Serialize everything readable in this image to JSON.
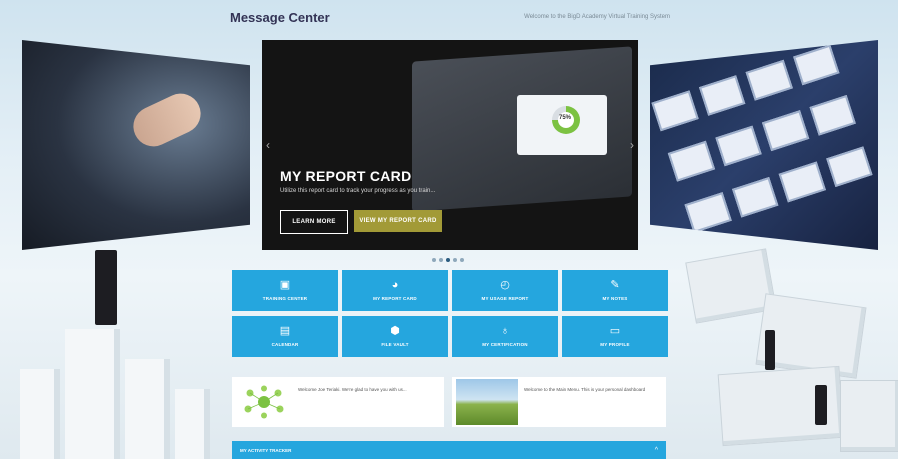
{
  "header": {
    "title": "Message Center",
    "welcome": "Welcome to the BigD Academy Virtual Training System"
  },
  "hero": {
    "title": "MY REPORT CARD",
    "subtitle": "Utilize this report card to track your progress as you train...",
    "donut_label": "75%",
    "donut_value": 0.75,
    "learn_more": "LEARN MORE",
    "view_report": "VIEW MY REPORT CARD",
    "prev_arrow": "‹",
    "next_arrow": "›",
    "slide_count": 5,
    "active_slide": 3
  },
  "tiles": [
    {
      "label": "TRAINING CENTER",
      "icon": "monitor-icon",
      "glyph": "▣"
    },
    {
      "label": "MY REPORT CARD",
      "icon": "pie-chart-icon",
      "glyph": "◕"
    },
    {
      "label": "MY USAGE REPORT",
      "icon": "gauge-icon",
      "glyph": "◴"
    },
    {
      "label": "MY NOTES",
      "icon": "edit-icon",
      "glyph": "✎"
    },
    {
      "label": "CALENDAR",
      "icon": "calendar-icon",
      "glyph": "▤"
    },
    {
      "label": "FILE VAULT",
      "icon": "folder-icon",
      "glyph": "⬢"
    },
    {
      "label": "MY CERTIFICATION",
      "icon": "award-icon",
      "glyph": "♁"
    },
    {
      "label": "MY PROFILE",
      "icon": "id-card-icon",
      "glyph": "▭"
    }
  ],
  "messages": [
    {
      "text": "Welcome Joe Teriaki. We're glad to have you with us..."
    },
    {
      "text": "Welcome to the Main Menu. This is your personal dashboard"
    }
  ],
  "activity": {
    "label": "MY ACTIVITY TRACKER",
    "caret": "^"
  },
  "colors": {
    "tile_blue": "#25a6de",
    "accent_olive": "#a29a37"
  }
}
